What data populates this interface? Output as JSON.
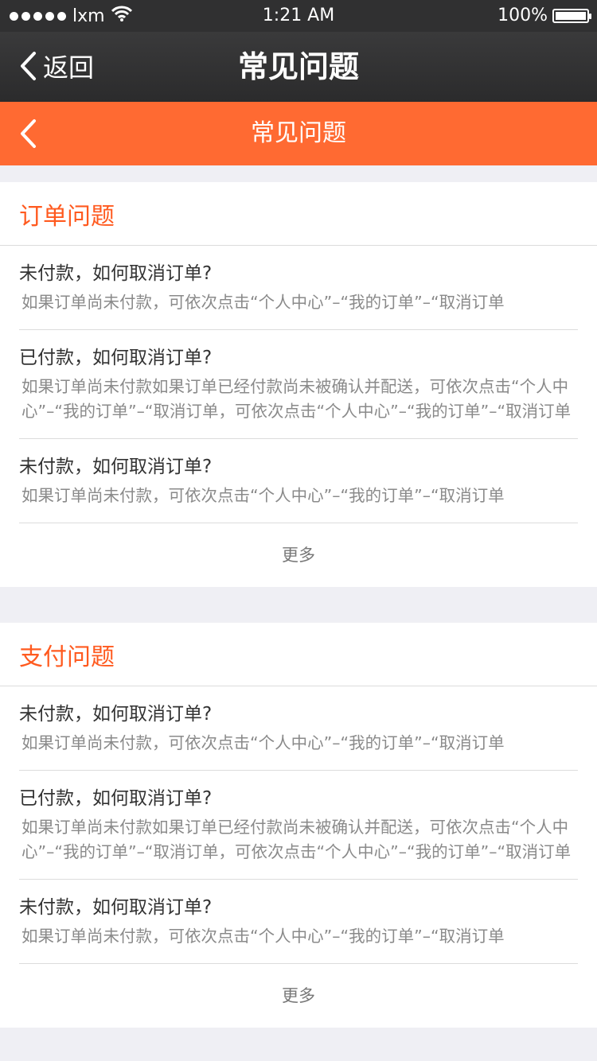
{
  "status_bar": {
    "carrier": "lxm",
    "time": "1:21 AM",
    "battery": "100%"
  },
  "dark_nav": {
    "back_label": "返回",
    "title": "常见问题"
  },
  "orange_nav": {
    "title": "常见问题"
  },
  "sections": [
    {
      "title": "订单问题",
      "items": [
        {
          "q": "未付款，如何取消订单?",
          "a": "如果订单尚未付款，可依次点击“个人中心”–“我的订单”–“取消订单"
        },
        {
          "q": "已付款，如何取消订单?",
          "a": "如果订单尚未付款如果订单已经付款尚未被确认并配送，可依次点击“个人中心”–“我的订单”–“取消订单，可依次点击“个人中心”–“我的订单”–“取消订单"
        },
        {
          "q": "未付款，如何取消订单?",
          "a": "如果订单尚未付款，可依次点击“个人中心”–“我的订单”–“取消订单"
        }
      ],
      "more_label": "更多"
    },
    {
      "title": "支付问题",
      "items": [
        {
          "q": "未付款，如何取消订单?",
          "a": "如果订单尚未付款，可依次点击“个人中心”–“我的订单”–“取消订单"
        },
        {
          "q": "已付款，如何取消订单?",
          "a": "如果订单尚未付款如果订单已经付款尚未被确认并配送，可依次点击“个人中心”–“我的订单”–“取消订单，可依次点击“个人中心”–“我的订单”–“取消订单"
        },
        {
          "q": "未付款，如何取消订单?",
          "a": "如果订单尚未付款，可依次点击“个人中心”–“我的订单”–“取消订单"
        }
      ],
      "more_label": "更多"
    }
  ]
}
